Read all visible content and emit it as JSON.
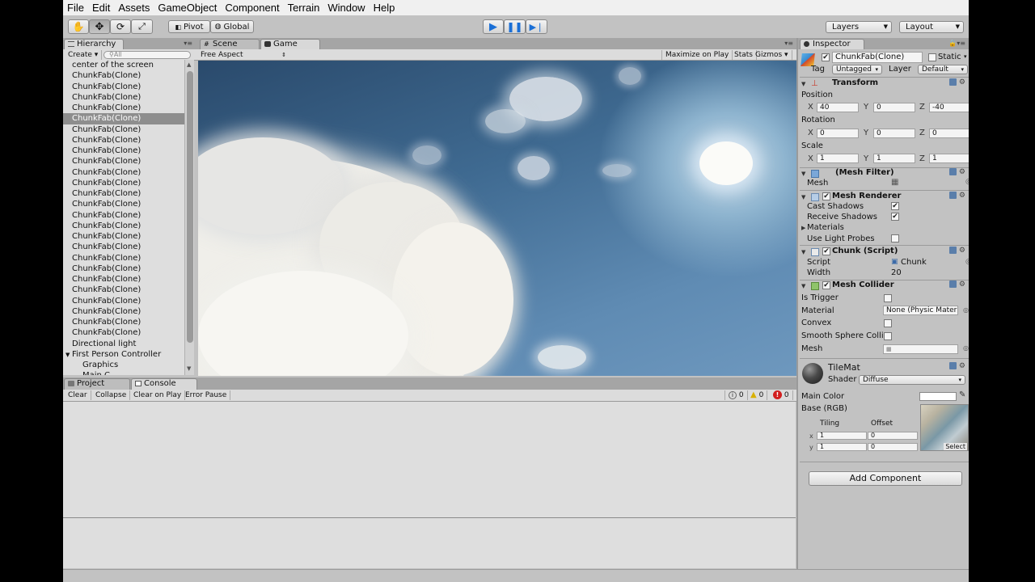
{
  "menu": [
    "File",
    "Edit",
    "Assets",
    "GameObject",
    "Component",
    "Terrain",
    "Window",
    "Help"
  ],
  "toolbar": {
    "pivot": "Pivot",
    "global": "Global",
    "layers": "Layers",
    "layout": "Layout"
  },
  "hierarchy": {
    "tab": "Hierarchy",
    "create": "Create",
    "search_placeholder": "All",
    "items": [
      {
        "label": "center of the screen",
        "kind": "item"
      },
      {
        "label": "ChunkFab(Clone)",
        "kind": "item"
      },
      {
        "label": "ChunkFab(Clone)",
        "kind": "item"
      },
      {
        "label": "ChunkFab(Clone)",
        "kind": "item"
      },
      {
        "label": "ChunkFab(Clone)",
        "kind": "item"
      },
      {
        "label": "ChunkFab(Clone)",
        "kind": "selected"
      },
      {
        "label": "ChunkFab(Clone)",
        "kind": "item"
      },
      {
        "label": "ChunkFab(Clone)",
        "kind": "item"
      },
      {
        "label": "ChunkFab(Clone)",
        "kind": "item"
      },
      {
        "label": "ChunkFab(Clone)",
        "kind": "item"
      },
      {
        "label": "ChunkFab(Clone)",
        "kind": "item"
      },
      {
        "label": "ChunkFab(Clone)",
        "kind": "item"
      },
      {
        "label": "ChunkFab(Clone)",
        "kind": "item"
      },
      {
        "label": "ChunkFab(Clone)",
        "kind": "item"
      },
      {
        "label": "ChunkFab(Clone)",
        "kind": "item"
      },
      {
        "label": "ChunkFab(Clone)",
        "kind": "item"
      },
      {
        "label": "ChunkFab(Clone)",
        "kind": "item"
      },
      {
        "label": "ChunkFab(Clone)",
        "kind": "item"
      },
      {
        "label": "ChunkFab(Clone)",
        "kind": "item"
      },
      {
        "label": "ChunkFab(Clone)",
        "kind": "item"
      },
      {
        "label": "ChunkFab(Clone)",
        "kind": "item"
      },
      {
        "label": "ChunkFab(Clone)",
        "kind": "item"
      },
      {
        "label": "ChunkFab(Clone)",
        "kind": "item"
      },
      {
        "label": "ChunkFab(Clone)",
        "kind": "item"
      },
      {
        "label": "ChunkFab(Clone)",
        "kind": "item"
      },
      {
        "label": "ChunkFab(Clone)",
        "kind": "item"
      },
      {
        "label": "Directional light",
        "kind": "item"
      },
      {
        "label": "First Person Controller",
        "kind": "parent"
      },
      {
        "label": "Graphics",
        "kind": "child"
      },
      {
        "label": "Main C...",
        "kind": "child"
      }
    ]
  },
  "views": {
    "scene_tab": "Scene",
    "game_tab": "Game",
    "aspect": "Free Aspect",
    "maximize": "Maximize on Play",
    "stats": "Stats",
    "gizmos": "Gizmos"
  },
  "bottom": {
    "project_tab": "Project",
    "console_tab": "Console",
    "clear": "Clear",
    "collapse": "Collapse",
    "clear_on_play": "Clear on Play",
    "error_pause": "Error Pause",
    "log_count": "0",
    "warn_count": "0",
    "error_count": "0"
  },
  "inspector": {
    "tab": "Inspector",
    "object_name": "ChunkFab(Clone)",
    "static_label": "Static",
    "tag_label": "Tag",
    "tag_value": "Untagged",
    "layer_label": "Layer",
    "layer_value": "Default",
    "transform": {
      "title": "Transform",
      "position_label": "Position",
      "rotation_label": "Rotation",
      "scale_label": "Scale",
      "position": {
        "x": "40",
        "y": "0",
        "z": "-40"
      },
      "rotation": {
        "x": "0",
        "y": "0",
        "z": "0"
      },
      "scale": {
        "x": "1",
        "y": "1",
        "z": "1"
      }
    },
    "mesh_filter": {
      "title": "(Mesh Filter)",
      "mesh_label": "Mesh"
    },
    "mesh_renderer": {
      "title": "Mesh Renderer",
      "cast_shadows": "Cast Shadows",
      "receive_shadows": "Receive Shadows",
      "materials": "Materials",
      "use_light_probes": "Use Light Probes"
    },
    "chunk_script": {
      "title": "Chunk (Script)",
      "script_label": "Script",
      "script_value": "Chunk",
      "width_label": "Width",
      "width_value": "20"
    },
    "mesh_collider": {
      "title": "Mesh Collider",
      "is_trigger": "Is Trigger",
      "material_label": "Material",
      "material_value": "None (Physic Mater",
      "convex": "Convex",
      "smooth_sphere": "Smooth Sphere Colli",
      "mesh_label": "Mesh"
    },
    "material": {
      "name": "TileMat",
      "shader_label": "Shader",
      "shader_value": "Diffuse",
      "main_color": "Main Color",
      "base_rgb": "Base (RGB)",
      "tiling": "Tiling",
      "offset": "Offset",
      "tiling_x": "1",
      "tiling_y": "1",
      "offset_x": "0",
      "offset_y": "0",
      "select": "Select"
    },
    "add_component": "Add Component"
  },
  "colors": {
    "editor_bg": "#c2c2c2",
    "selection": "#8e8e8e",
    "play_blue": "#1a6fd6"
  }
}
